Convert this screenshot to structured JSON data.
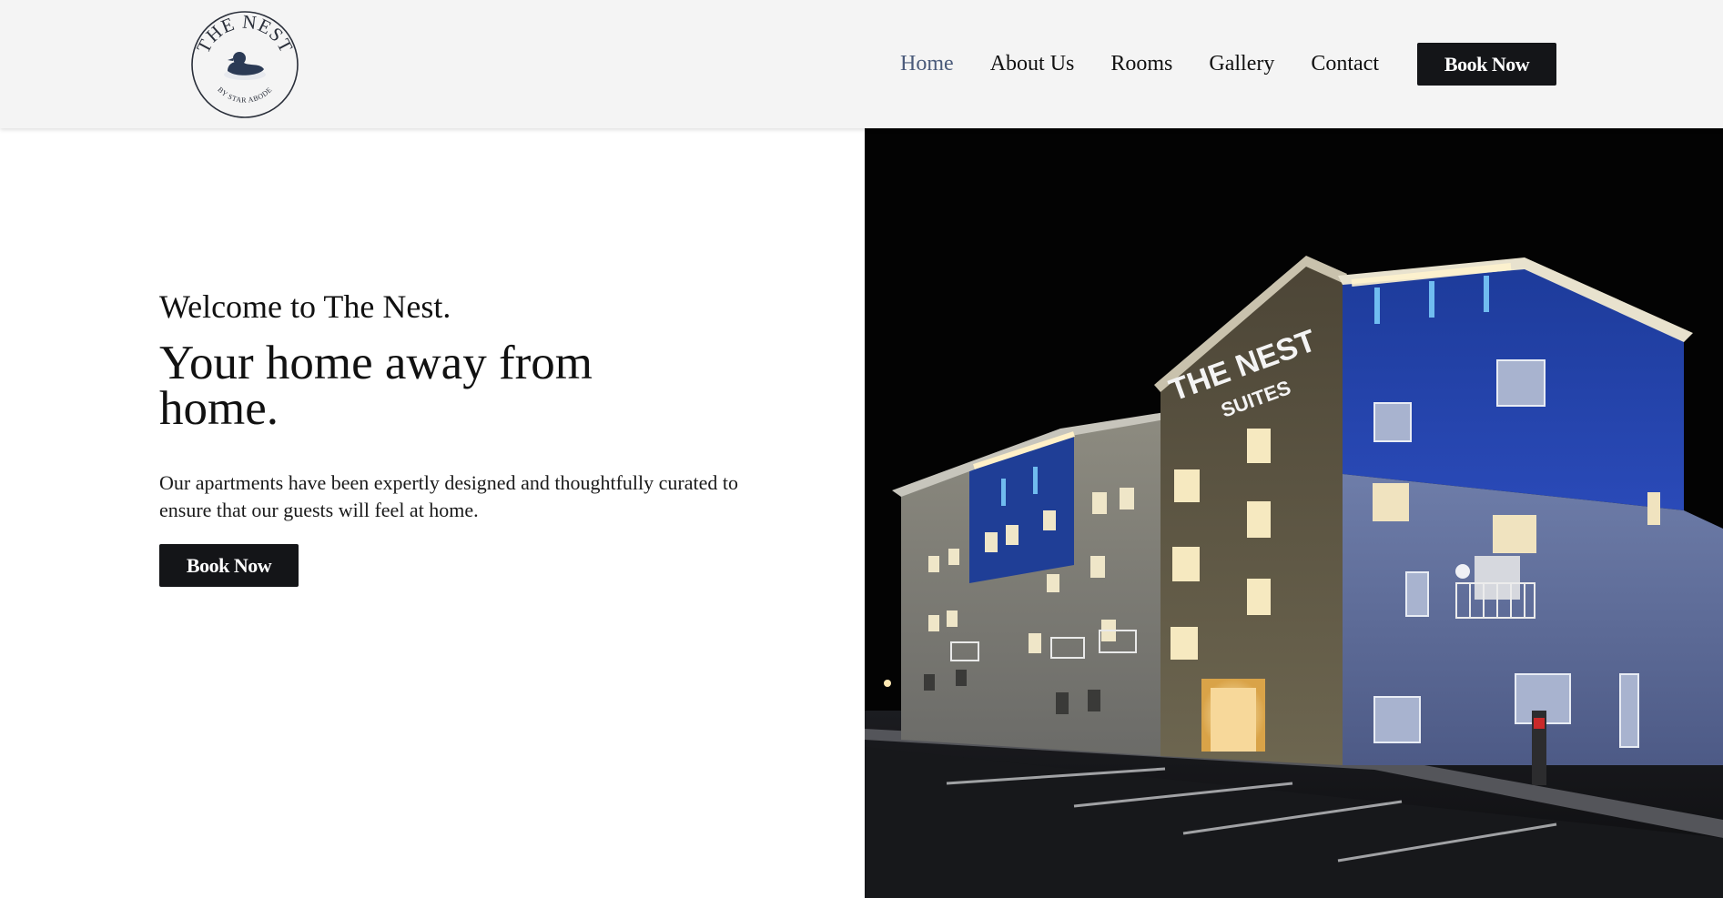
{
  "header": {
    "logo": {
      "brand_text": "THE NEST",
      "sub_text": "BY STAR ABODE",
      "icon": "duck-logo-icon"
    },
    "nav": [
      {
        "label": "Home",
        "active": true
      },
      {
        "label": "About Us",
        "active": false
      },
      {
        "label": "Rooms",
        "active": false
      },
      {
        "label": "Gallery",
        "active": false
      },
      {
        "label": "Contact",
        "active": false
      }
    ],
    "book_button_label": "Book Now"
  },
  "hero": {
    "welcome": "Welcome to The Nest.",
    "headline": "Your home away from home.",
    "description": "Our apartments have been expertly designed and thoughtfully curated to ensure that our guests will feel at home.",
    "book_button_label": "Book Now",
    "photo": {
      "sign_line1": "THE NEST",
      "sign_line2": "SUITES"
    }
  },
  "colors": {
    "header_bg": "#f4f4f4",
    "active_nav": "#4a5a7a",
    "button_bg": "#141518",
    "button_text": "#ffffff",
    "photo_bg": "#030303"
  }
}
